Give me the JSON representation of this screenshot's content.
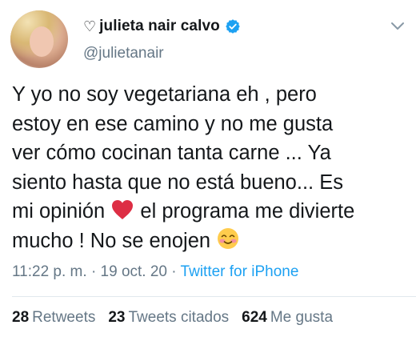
{
  "tweet": {
    "author": {
      "name_prefix": "♡",
      "display_name": "julieta nair calvo",
      "handle": "@julietanair"
    },
    "text": {
      "line1": "Y yo no soy vegetariana eh , pero",
      "line2": "estoy en ese camino y no me gusta",
      "line3": "ver cómo cocinan tanta carne ... Ya",
      "line4": "siento hasta que no está bueno... Es",
      "line5_a": "mi opinión",
      "line5_b": "el programa me divierte",
      "line6": "mucho ! No se enojen"
    },
    "meta": {
      "time": "11:22 p. m.",
      "separator": "·",
      "date": "19 oct. 20",
      "source": "Twitter for iPhone"
    },
    "stats": [
      {
        "count": "28",
        "label": "Retweets"
      },
      {
        "count": "23",
        "label": "Tweets citados"
      },
      {
        "count": "624",
        "label": "Me gusta"
      }
    ]
  },
  "icons": {
    "verified": "verified-badge-icon",
    "red_heart": "red-heart-emoji",
    "smile": "smiling-blushing-emoji",
    "chevron": "chevron-down-icon"
  },
  "colors": {
    "text": "#14171a",
    "secondary": "#657786",
    "link": "#1da1f2",
    "verified": "#1da1f2",
    "heart": "#dd2e44"
  }
}
